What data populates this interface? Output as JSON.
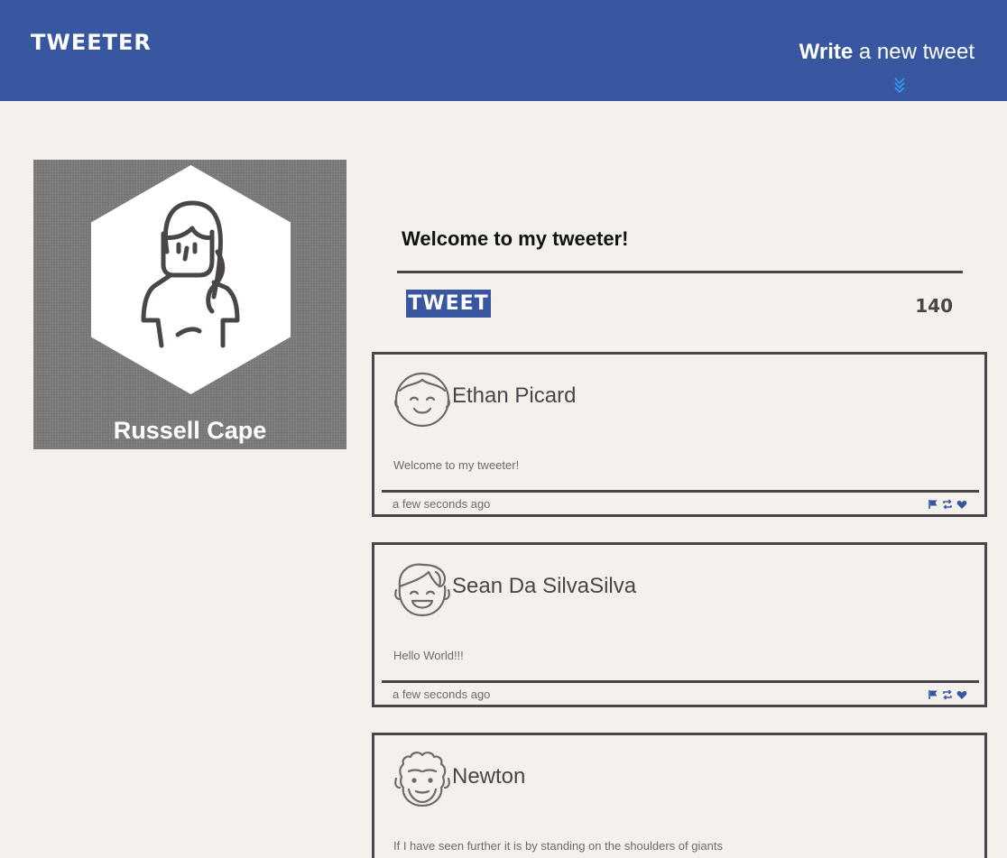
{
  "header": {
    "brand": "TWEETER",
    "compose_toggle_bold": "Write",
    "compose_toggle_rest": " a new tweet"
  },
  "profile": {
    "name": "Russell Cape"
  },
  "compose": {
    "text": "Welcome to my tweeter!",
    "button_label": "TWEET",
    "counter": "140"
  },
  "tweets": [
    {
      "author": "Ethan Picard",
      "body": "Welcome to my tweeter!",
      "time": "a few seconds ago",
      "avatar_icon": "smiling-man-avatar-icon"
    },
    {
      "author": "Sean Da SilvaSilva",
      "body": "Hello World!!!",
      "time": "a few seconds ago",
      "avatar_icon": "laughing-man-avatar-icon"
    },
    {
      "author": "Newton",
      "body": "If I have seen further it is by standing on the shoulders of giants",
      "time": "",
      "avatar_icon": "curly-hair-avatar-icon"
    }
  ],
  "colors": {
    "brand_blue": "#3857a0",
    "background": "#f4f1ec",
    "border": "#4a4548",
    "chevron": "#2b9bf4"
  }
}
